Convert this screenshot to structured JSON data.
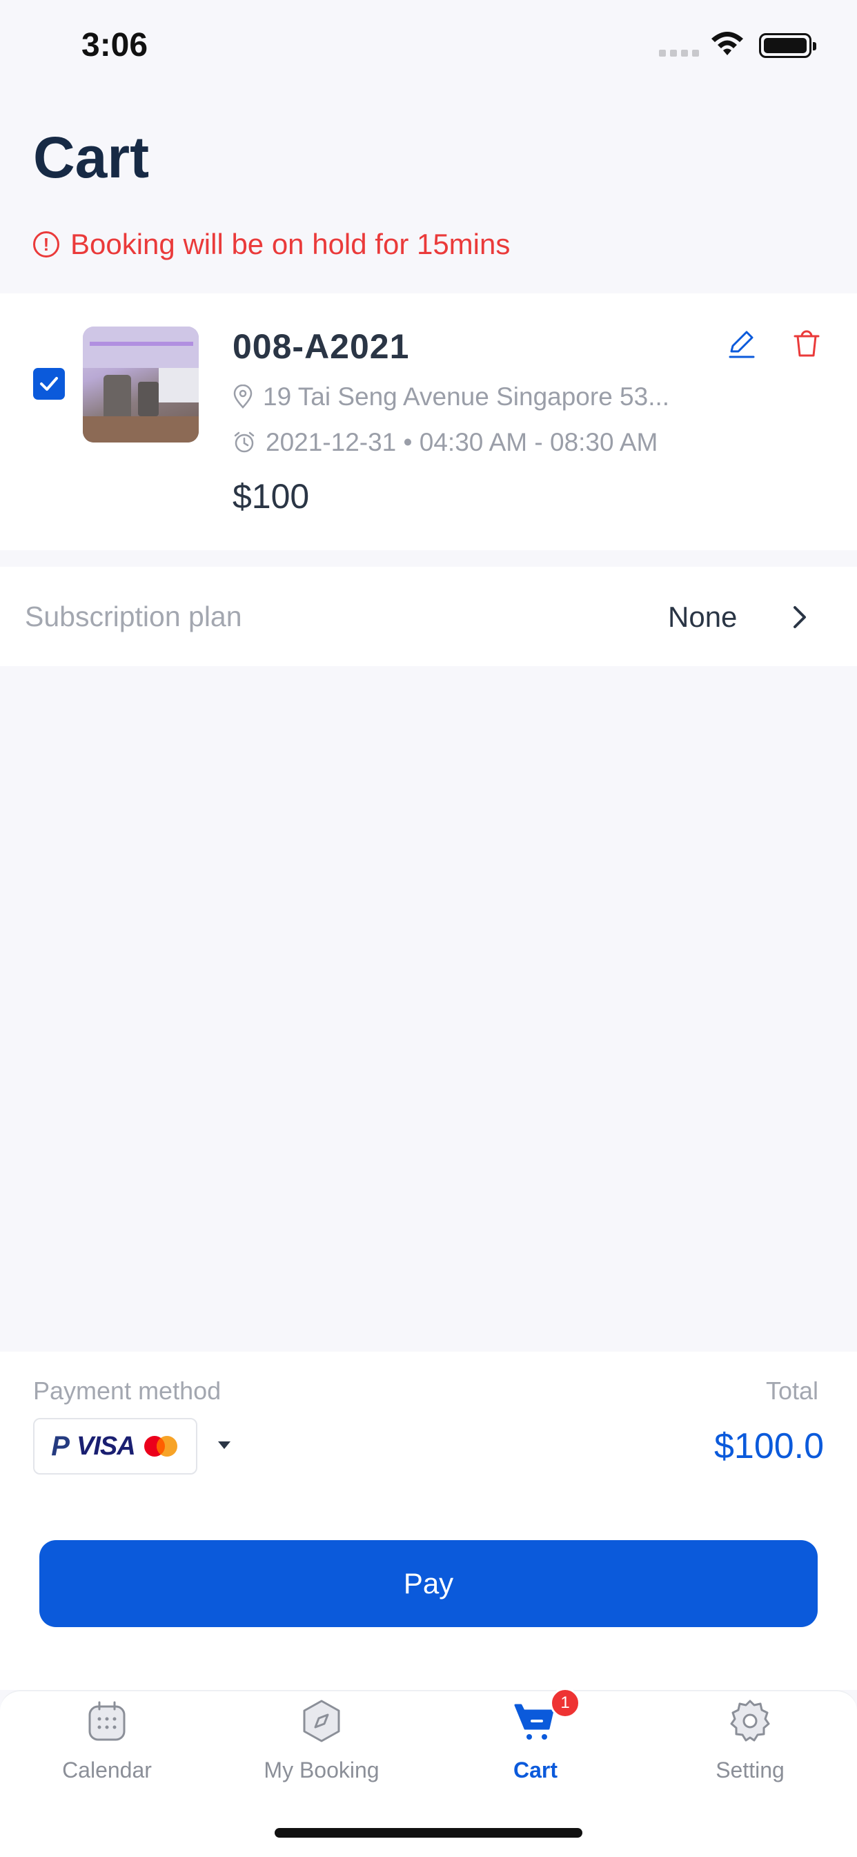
{
  "status_bar": {
    "time": "3:06"
  },
  "header": {
    "title": "Cart",
    "hold_notice": "Booking will be on hold for 15mins"
  },
  "cart_item": {
    "checked": true,
    "name": "008-A2021",
    "address": "19 Tai Seng Avenue Singapore 53...",
    "datetime": "2021-12-31 • 04:30 AM - 08:30 AM",
    "price": "$100"
  },
  "subscription": {
    "label": "Subscription plan",
    "value": "None"
  },
  "payment": {
    "label": "Payment method",
    "brands": {
      "paypal": "P",
      "visa": "VISA"
    },
    "total_label": "Total",
    "total_value": "$100.0",
    "pay_button": "Pay"
  },
  "tabs": [
    {
      "label": "Calendar",
      "icon": "calendar-icon",
      "active": false
    },
    {
      "label": "My Booking",
      "icon": "compass-icon",
      "active": false
    },
    {
      "label": "Cart",
      "icon": "cart-icon",
      "active": true,
      "badge": "1"
    },
    {
      "label": "Setting",
      "icon": "gear-icon",
      "active": false
    }
  ],
  "colors": {
    "accent": "#0b5adb",
    "danger": "#ea3a3a",
    "title": "#172a45",
    "muted": "#a3a7b0"
  }
}
